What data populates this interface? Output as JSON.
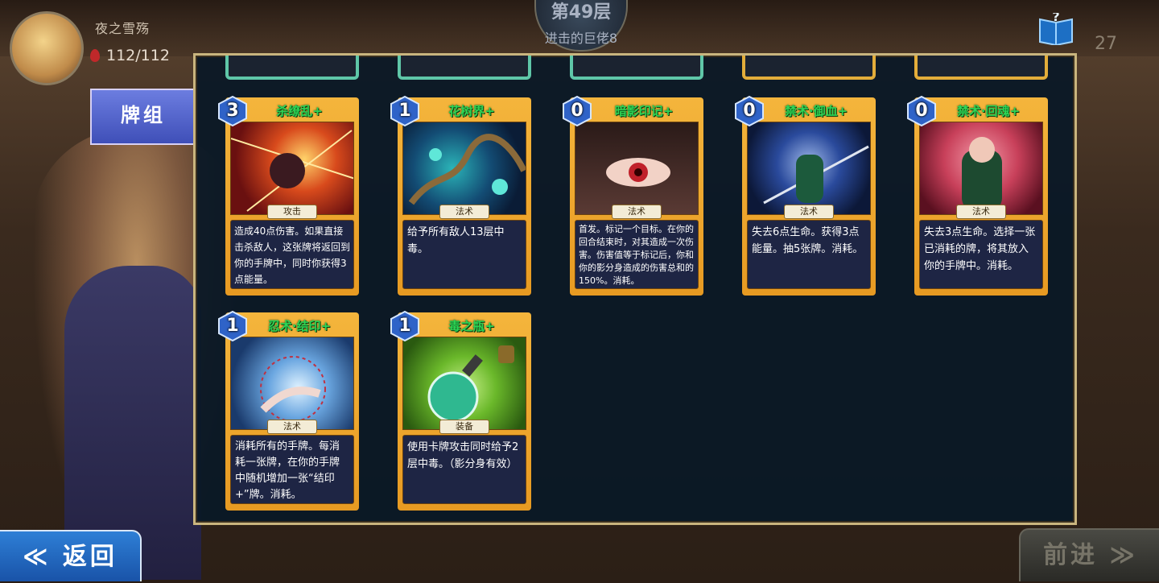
{
  "player": {
    "name": "夜之雪殇",
    "hp": "112/112"
  },
  "floor": {
    "number": "第49层",
    "title": "进击的巨佬8"
  },
  "top_right": {
    "count": "27"
  },
  "tab": {
    "deck_label": "牌组"
  },
  "buttons": {
    "back_label": "≪ 返回",
    "next_label": "前进 ≫"
  },
  "cards": [
    {
      "cost": "3",
      "name": "杀缭乱+",
      "type": "攻击",
      "desc": "造成40点伤害。如果直接击杀敌人，这张牌将返回到你的手牌中，同时你获得3点能量。"
    },
    {
      "cost": "1",
      "name": "花树界+",
      "type": "法术",
      "desc": "给予所有敌人13层中毒。"
    },
    {
      "cost": "0",
      "name": "暗影印记+",
      "type": "法术",
      "desc": "首发。标记一个目标。在你的回合结束时，对其造成一次伤害。伤害值等于标记后，你和你的影分身造成的伤害总和的150%。消耗。"
    },
    {
      "cost": "0",
      "name": "禁术·御血+",
      "type": "法术",
      "desc": "失去6点生命。获得3点能量。抽5张牌。消耗。"
    },
    {
      "cost": "0",
      "name": "禁术·回魂+",
      "type": "法术",
      "desc": "失去3点生命。选择一张已消耗的牌，将其放入你的手牌中。消耗。"
    },
    {
      "cost": "1",
      "name": "忍术·结印+",
      "type": "法术",
      "desc": "消耗所有的手牌。每消耗一张牌，在你的手牌中随机增加一张“结印+”牌。消耗。"
    },
    {
      "cost": "1",
      "name": "毒之瓶+",
      "type": "装备",
      "desc": "使用卡牌攻击同时给予2层中毒。（影分身有效）"
    }
  ],
  "colors": {
    "card_frame": "#e79a22",
    "card_name": "#2dd455",
    "cost_gem": "#2f63c8",
    "panel_border": "#c9b57e",
    "back_button": "#1953a8"
  }
}
